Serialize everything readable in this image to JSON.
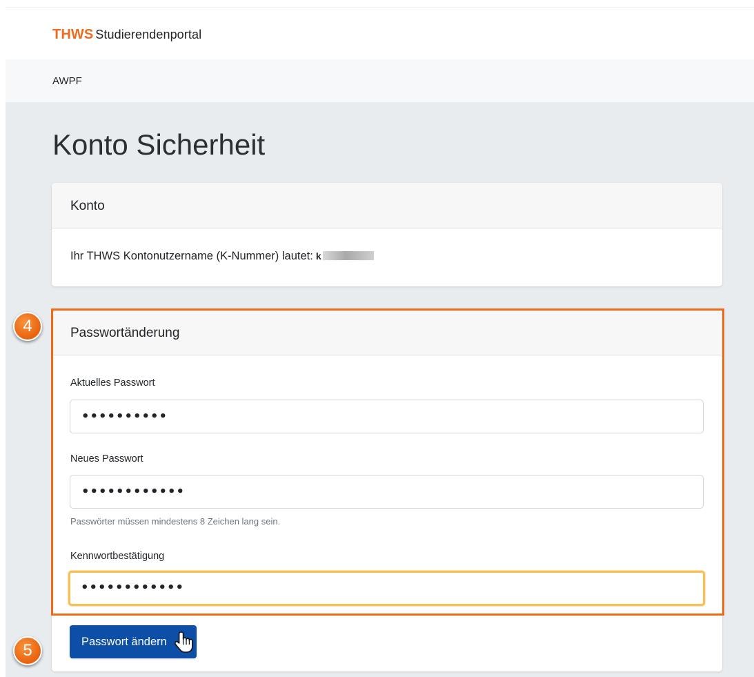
{
  "header": {
    "brand_logo": "THWS",
    "brand_portal": "Studierendenportal"
  },
  "subnav": {
    "item": "AWPF"
  },
  "page": {
    "title": "Konto Sicherheit"
  },
  "account_card": {
    "title": "Konto",
    "username_text": "Ihr THWS Kontonutzername (K-Nummer) lautet:",
    "username_prefix": "k"
  },
  "password_card": {
    "title": "Passwortänderung",
    "current_label": "Aktuelles Passwort",
    "current_value": "••••••••••",
    "new_label": "Neues Passwort",
    "new_value": "••••••••••••",
    "hint": "Passwörter müssen mindestens 8 Zeichen lang sein.",
    "confirm_label": "Kennwortbestätigung",
    "confirm_value": "••••••••••••",
    "submit_label": "Passwort ändern"
  },
  "annotations": {
    "step_4": "4",
    "step_5": "5",
    "accent_color": "#ee6a16"
  },
  "colors": {
    "brand": "#ec6b1e",
    "primary_button": "#0d4ea6",
    "focus_ring": "#f6bf5a"
  }
}
